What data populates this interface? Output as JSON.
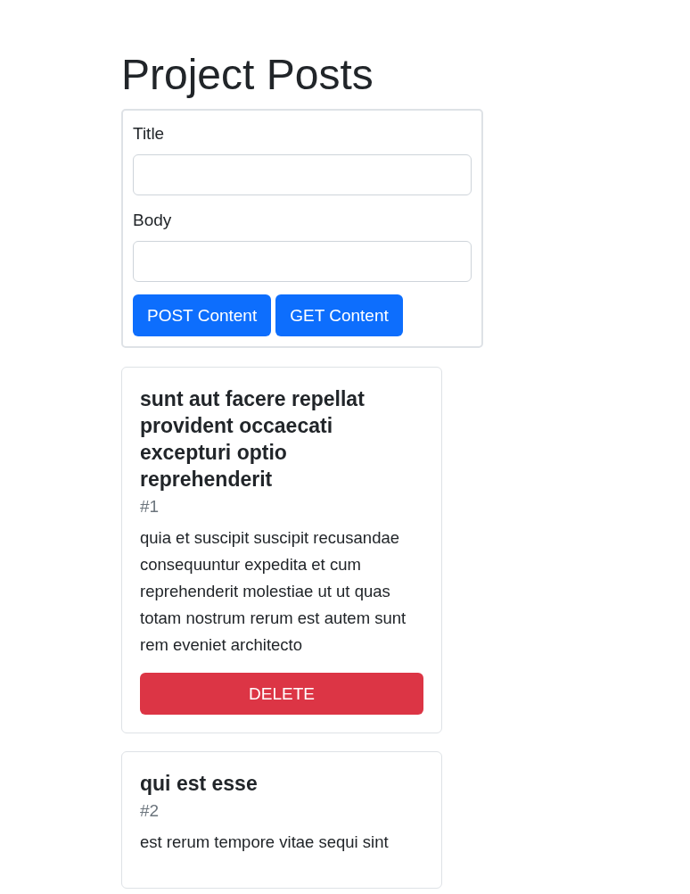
{
  "heading": "Project Posts",
  "form": {
    "fields": [
      {
        "label": "Title"
      },
      {
        "label": "Body"
      }
    ],
    "buttons": [
      {
        "label": "POST Content"
      },
      {
        "label": "GET Content"
      }
    ]
  },
  "posts": [
    {
      "title": "sunt aut facere repellat provident occaecati excepturi optio reprehenderit",
      "number": "#1",
      "body": "quia et suscipit suscipit recusandae consequuntur expedita et cum reprehenderit molestiae ut ut quas totam nostrum rerum est autem sunt rem eveniet architecto",
      "button": "DELETE"
    },
    {
      "title": "qui est esse",
      "number": "#2",
      "body": "est rerum tempore vitae sequi sint"
    }
  ]
}
